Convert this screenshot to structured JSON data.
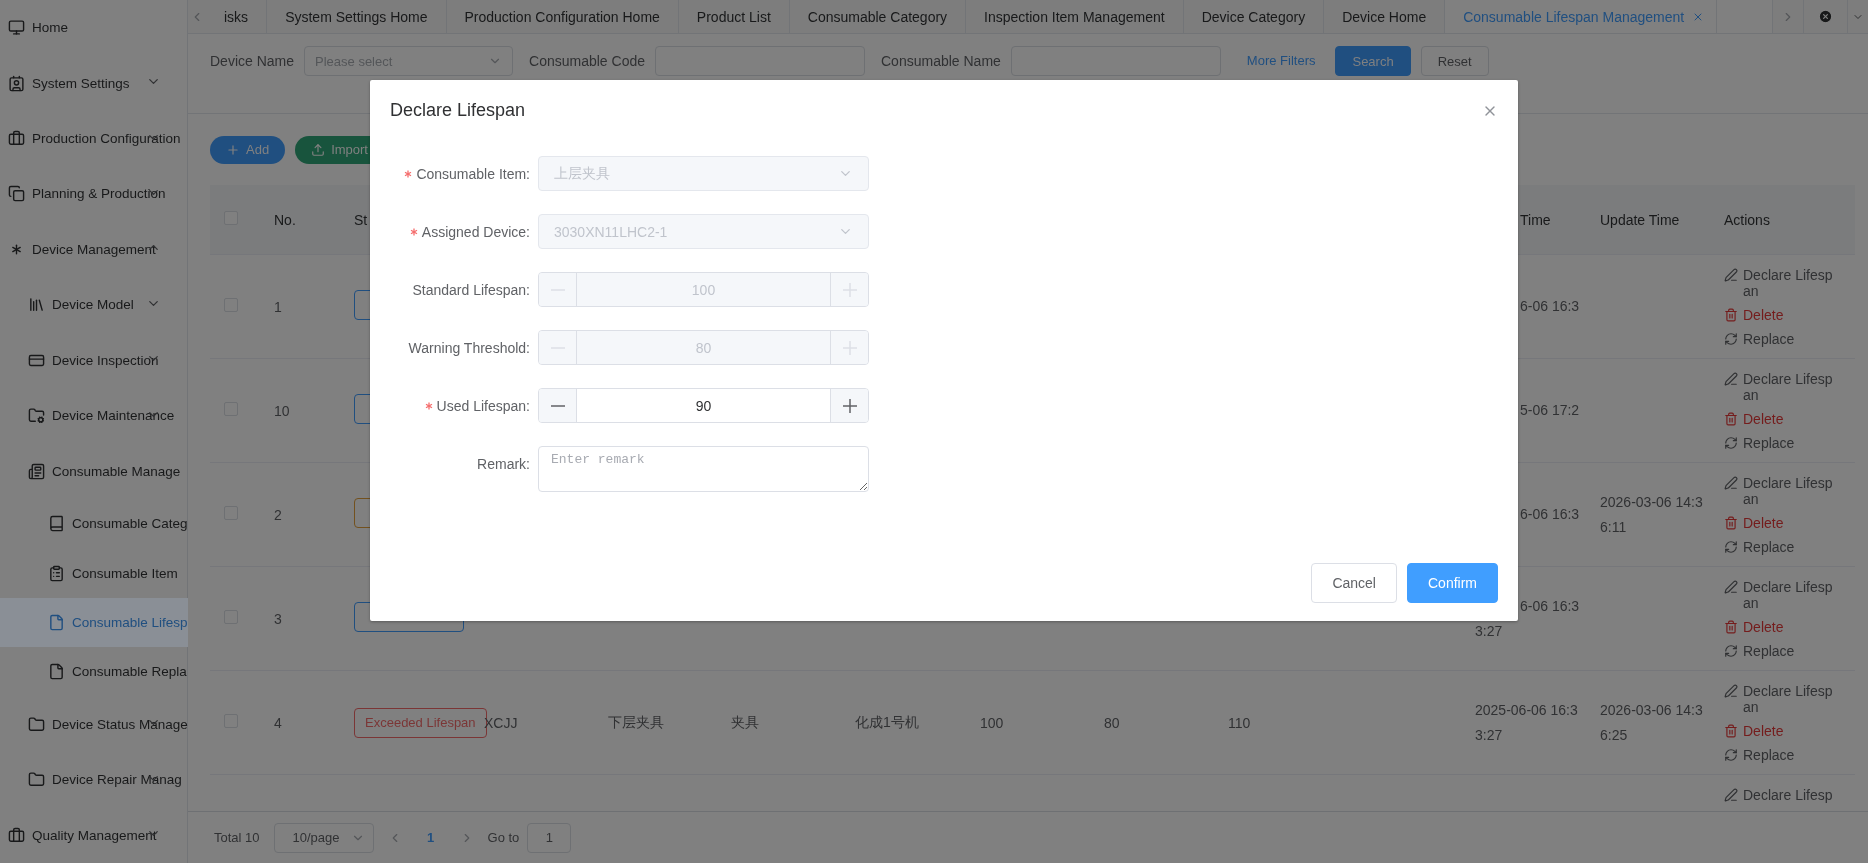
{
  "tabs": [
    {
      "label": "isks",
      "selected": false
    },
    {
      "label": "System Settings Home",
      "selected": false
    },
    {
      "label": "Production Configuration Home",
      "selected": false
    },
    {
      "label": "Product List",
      "selected": false
    },
    {
      "label": "Consumable Category",
      "selected": false
    },
    {
      "label": "Inspection Item Management",
      "selected": false
    },
    {
      "label": "Device Category",
      "selected": false
    },
    {
      "label": "Device Home",
      "selected": false
    },
    {
      "label": "Consumable Lifespan Management",
      "selected": true
    }
  ],
  "sidebar": {
    "items": [
      {
        "label": "Home",
        "selected": false
      },
      {
        "label": "System Settings",
        "selected": false,
        "expanded": false
      },
      {
        "label": "Production Configuration",
        "selected": false,
        "expanded": false
      },
      {
        "label": "Planning & Production",
        "selected": false,
        "expanded": false
      },
      {
        "label": "Device Management",
        "selected": false,
        "expanded": true,
        "children": [
          {
            "label": "Device Model",
            "selected": false,
            "expanded": false
          },
          {
            "label": "Device Inspection",
            "selected": false,
            "expanded": false
          },
          {
            "label": "Device Maintenance",
            "selected": false,
            "expanded": false
          },
          {
            "label": "Consumable Manage",
            "selected": false,
            "children": [
              {
                "label": "Consumable Categ",
                "selected": false
              },
              {
                "label": "Consumable Item",
                "selected": false
              },
              {
                "label": "Consumable Lifesp",
                "selected": true
              },
              {
                "label": "Consumable Repla",
                "selected": false
              }
            ]
          },
          {
            "label": "Device Status Manage",
            "selected": false,
            "expanded": false
          },
          {
            "label": "Device Repair Manag",
            "selected": false,
            "expanded": false
          }
        ]
      },
      {
        "label": "Quality Management",
        "selected": false,
        "expanded": false
      }
    ]
  },
  "filters": {
    "fields": [
      {
        "kind": "select",
        "label": "Device Name",
        "placeholder": "Please select"
      },
      {
        "kind": "input",
        "label": "Consumable Code"
      },
      {
        "kind": "input",
        "label": "Consumable Name"
      }
    ],
    "more_filters": "More Filters",
    "buttons": [
      {
        "kind": "primary",
        "label": "Search"
      },
      {
        "kind": "default",
        "label": "Reset"
      }
    ]
  },
  "toolbar": [
    {
      "kind": "add",
      "label": "Add"
    },
    {
      "kind": "import",
      "label": "Import"
    }
  ],
  "table": {
    "header": {
      "checked": false,
      "no": "No.",
      "status": "St",
      "create_time": "Time",
      "update_time": "Update Time",
      "actions": "Actions",
      "behind_dialog": true
    },
    "rows": [
      {
        "behind_dialog": true,
        "checked": false,
        "no": "1",
        "status": {
          "color": "#204f80"
        },
        "create_time": "6-06 16:3",
        "actions": [
          {
            "kind": "declare",
            "label": "Declare Lifespan"
          },
          {
            "kind": "delete",
            "label": "Delete"
          },
          {
            "kind": "replace",
            "label": "Replace"
          }
        ]
      },
      {
        "behind_dialog": true,
        "checked": false,
        "no": "10",
        "status": {
          "color": "#204f80"
        },
        "create_time": "5-06 17:2",
        "actions": [
          {
            "kind": "declare",
            "label": "Declare Lifespan"
          },
          {
            "kind": "delete",
            "label": "Delete"
          },
          {
            "kind": "replace",
            "label": "Replace"
          }
        ]
      },
      {
        "behind_dialog": true,
        "checked": false,
        "no": "2",
        "status": {
          "color": "#73511e"
        },
        "create_time": "6-06 16:3",
        "update_time": "2026-03-06 14:36:11",
        "actions": [
          {
            "kind": "declare",
            "label": "Declare Lifespan"
          },
          {
            "kind": "delete",
            "label": "Delete"
          },
          {
            "kind": "replace",
            "label": "Replace"
          }
        ]
      },
      {
        "behind_dialog": true,
        "checked": false,
        "no": "3",
        "status": {
          "color": "#204f80"
        },
        "create_time": "6-06 16:3 3:27",
        "actions": [
          {
            "kind": "declare",
            "label": "Declare Lifespan"
          },
          {
            "kind": "delete",
            "label": "Delete"
          },
          {
            "kind": "replace",
            "label": "Replace"
          }
        ]
      },
      {
        "behind_dialog": false,
        "checked": false,
        "no": "4",
        "status": {
          "label": "Exceeded Lifespan",
          "color": "#7b3636"
        },
        "code": "XCJJ",
        "name": "下层夹具",
        "category": "夹具",
        "device": "化成1号机",
        "standard": "100",
        "warning": "80",
        "used": "110",
        "create_time": "2025-06-06 16:33:27",
        "update_time": "2026-03-06 14:36:25",
        "actions": [
          {
            "kind": "declare",
            "label": "Declare Lifespan"
          },
          {
            "kind": "delete",
            "label": "Delete"
          },
          {
            "kind": "replace",
            "label": "Replace"
          }
        ]
      },
      {
        "actions": [
          {
            "kind": "declare",
            "label": "Declare Lifesp"
          }
        ]
      }
    ]
  },
  "pagination": {
    "total": "Total 10",
    "page_size": "10/page",
    "pages": [
      {
        "label": "1",
        "selected": true
      }
    ],
    "goto_label": "Go to",
    "goto_value": "1"
  },
  "modal": {
    "title": "Declare Lifespan",
    "fields": [
      {
        "kind": "select",
        "label": "Consumable Item:",
        "required": true,
        "disabled": true,
        "value": "上层夹具"
      },
      {
        "kind": "select",
        "label": "Assigned Device:",
        "required": true,
        "disabled": true,
        "value": "3030XN11LHC2-1"
      },
      {
        "kind": "number",
        "label": "Standard Lifespan:",
        "required": false,
        "disabled": true,
        "value": "100"
      },
      {
        "kind": "number",
        "label": "Warning Threshold:",
        "required": false,
        "disabled": true,
        "value": "80"
      },
      {
        "kind": "number",
        "label": "Used Lifespan:",
        "required": true,
        "disabled": false,
        "value": "90"
      },
      {
        "kind": "textarea",
        "label": "Remark:",
        "required": false,
        "placeholder": "Enter remark"
      }
    ],
    "buttons": [
      {
        "kind": "default",
        "label": "Cancel"
      },
      {
        "kind": "primary",
        "label": "Confirm"
      }
    ]
  }
}
